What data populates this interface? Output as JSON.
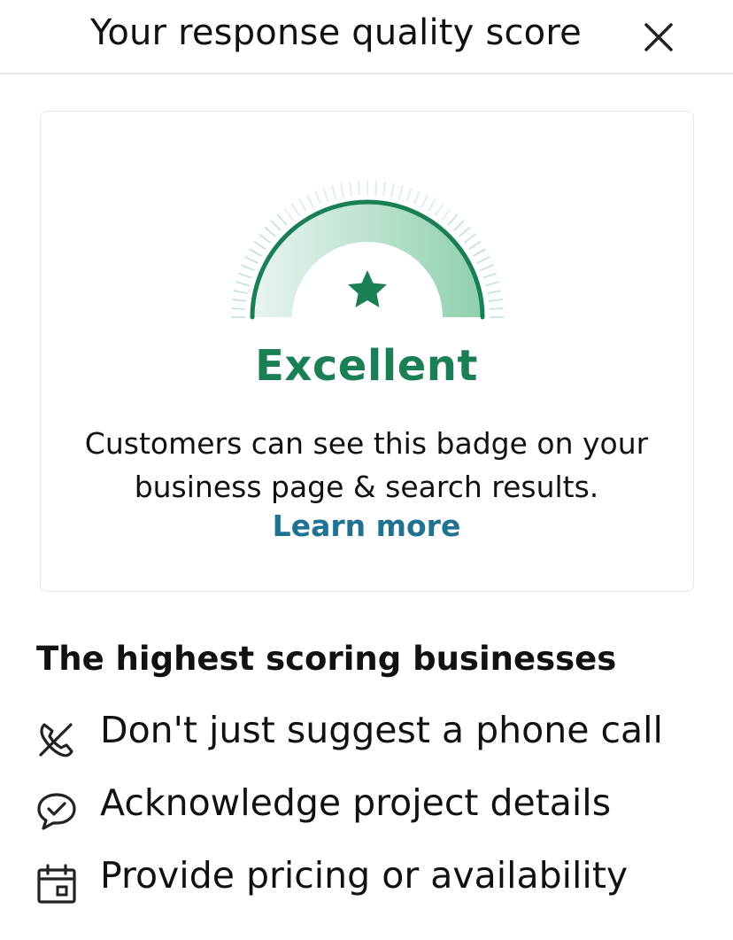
{
  "header": {
    "title": "Your response quality score",
    "close_icon": "close-icon"
  },
  "score_card": {
    "gauge_icon": "star-icon",
    "score_label": "Excellent",
    "description_line1": "Customers can see this badge on your",
    "description_line2": "business page & search results.",
    "learn_more": "Learn more",
    "colors": {
      "accent_green": "#1a7f55",
      "link_blue": "#1e7390"
    }
  },
  "tips": {
    "title": "The highest scoring businesses",
    "items": [
      {
        "icon": "phone-off-icon",
        "label": "Don't just suggest a phone call"
      },
      {
        "icon": "chat-check-icon",
        "label": "Acknowledge project details"
      },
      {
        "icon": "calendar-icon",
        "label": "Provide pricing or availability"
      }
    ]
  }
}
